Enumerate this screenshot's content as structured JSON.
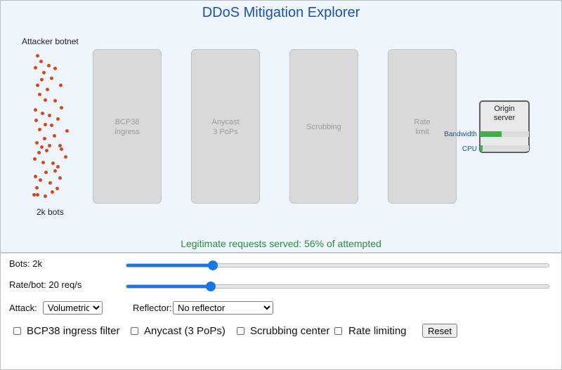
{
  "header": {
    "title": "DDoS Mitigation Explorer"
  },
  "botnet": {
    "label": "Attacker botnet",
    "count_label": "2k bots"
  },
  "stages": [
    {
      "label": "BCP38\ningress"
    },
    {
      "label": "Anycast\n3 PoPs"
    },
    {
      "label": "Scrubbing"
    },
    {
      "label": "Rate\nlimit"
    }
  ],
  "origin": {
    "title": "Origin\nserver",
    "bandwidth_label": "Bandwidth",
    "bandwidth_level": 0.44,
    "cpu_label": "CPU",
    "cpu_level": 0.06
  },
  "status": {
    "served_text": "Legitimate requests served: 56% of attempted"
  },
  "controls": {
    "bots_label": "Bots: 2k",
    "bots_level": 0.205,
    "rate_label": "Rate/bot: 20 req/s",
    "rate_level": 0.2,
    "attack_label": "Attack:",
    "attack_value": "Volumetric",
    "reflector_label": "Reflector:",
    "reflector_value": "No reflector",
    "bcp38_label": "BCP38 ingress filter",
    "anycast_label": "Anycast (3 PoPs)",
    "scrubbing_label": "Scrubbing center",
    "ratelimit_label": "Rate limiting",
    "reset_label": "Reset"
  },
  "colors": {
    "title": "#1a52a8",
    "bot": "#d8461c",
    "meter": "#3fae49",
    "served": "#2e8b3a",
    "slider": "#1676ee"
  }
}
